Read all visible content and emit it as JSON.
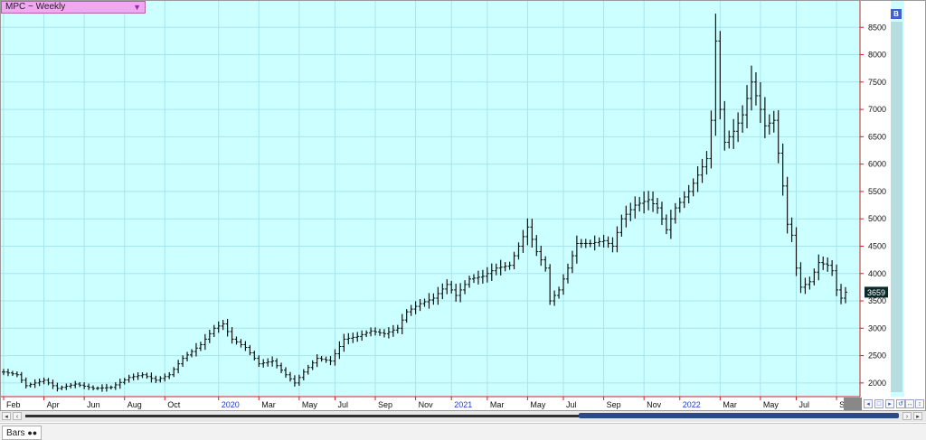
{
  "window": {
    "symbol_label": "MPC ~ Weekly",
    "badge": "B"
  },
  "status": {
    "view_tab": "Bars"
  },
  "colors": {
    "plot_bg": "#ccffff",
    "grid": "#a8e4ee",
    "axis": "#d02020",
    "bar": "#111111",
    "last_price_bg": "#0a2a2a"
  },
  "chart_data": {
    "type": "ohlc",
    "title": "",
    "xlabel": "",
    "ylabel": "",
    "ylim": [
      1750,
      8950
    ],
    "yticks": [
      2000,
      2500,
      3000,
      3500,
      4000,
      4500,
      5000,
      5500,
      6000,
      6500,
      7000,
      7500,
      8000,
      8500
    ],
    "last_price": 3659,
    "last_price_label": "3659",
    "xticks": [
      {
        "label": "Feb",
        "week": 0,
        "year": false
      },
      {
        "label": "Apr",
        "week": 9,
        "year": false
      },
      {
        "label": "Jun",
        "week": 18,
        "year": false
      },
      {
        "label": "Aug",
        "week": 27,
        "year": false
      },
      {
        "label": "Oct",
        "week": 36,
        "year": false
      },
      {
        "label": "2020",
        "week": 48,
        "year": true
      },
      {
        "label": "Mar",
        "week": 57,
        "year": false
      },
      {
        "label": "May",
        "week": 66,
        "year": false
      },
      {
        "label": "Jul",
        "week": 74,
        "year": false
      },
      {
        "label": "Sep",
        "week": 83,
        "year": false
      },
      {
        "label": "Nov",
        "week": 92,
        "year": false
      },
      {
        "label": "2021",
        "week": 100,
        "year": true
      },
      {
        "label": "Mar",
        "week": 108,
        "year": false
      },
      {
        "label": "May",
        "week": 117,
        "year": false
      },
      {
        "label": "Jul",
        "week": 125,
        "year": false
      },
      {
        "label": "Sep",
        "week": 134,
        "year": false
      },
      {
        "label": "Nov",
        "week": 143,
        "year": false
      },
      {
        "label": "2022",
        "week": 151,
        "year": true
      },
      {
        "label": "Mar",
        "week": 160,
        "year": false
      },
      {
        "label": "May",
        "week": 169,
        "year": false
      },
      {
        "label": "Jul",
        "week": 177,
        "year": false
      },
      {
        "label": "Sep",
        "week": 186,
        "year": false
      }
    ],
    "weeks": 189,
    "close_anchors": [
      [
        0,
        2200
      ],
      [
        3,
        2150
      ],
      [
        5,
        1950
      ],
      [
        9,
        2050
      ],
      [
        12,
        1900
      ],
      [
        16,
        1980
      ],
      [
        20,
        1900
      ],
      [
        24,
        1920
      ],
      [
        28,
        2100
      ],
      [
        31,
        2150
      ],
      [
        34,
        2050
      ],
      [
        37,
        2150
      ],
      [
        40,
        2450
      ],
      [
        44,
        2700
      ],
      [
        47,
        3000
      ],
      [
        49,
        3080
      ],
      [
        51,
        2800
      ],
      [
        54,
        2650
      ],
      [
        57,
        2350
      ],
      [
        60,
        2400
      ],
      [
        63,
        2150
      ],
      [
        65,
        2000
      ],
      [
        67,
        2200
      ],
      [
        70,
        2450
      ],
      [
        73,
        2400
      ],
      [
        76,
        2800
      ],
      [
        79,
        2850
      ],
      [
        82,
        2950
      ],
      [
        85,
        2900
      ],
      [
        88,
        3000
      ],
      [
        90,
        3300
      ],
      [
        93,
        3450
      ],
      [
        96,
        3550
      ],
      [
        99,
        3800
      ],
      [
        101,
        3600
      ],
      [
        104,
        3900
      ],
      [
        107,
        3950
      ],
      [
        110,
        4100
      ],
      [
        113,
        4150
      ],
      [
        115,
        4500
      ],
      [
        117,
        4850
      ],
      [
        119,
        4400
      ],
      [
        121,
        4100
      ],
      [
        122,
        3500
      ],
      [
        124,
        3700
      ],
      [
        126,
        4100
      ],
      [
        128,
        4550
      ],
      [
        131,
        4550
      ],
      [
        134,
        4600
      ],
      [
        136,
        4500
      ],
      [
        138,
        5000
      ],
      [
        141,
        5250
      ],
      [
        144,
        5350
      ],
      [
        146,
        5200
      ],
      [
        148,
        4800
      ],
      [
        150,
        5200
      ],
      [
        153,
        5500
      ],
      [
        155,
        5800
      ],
      [
        157,
        6100
      ],
      [
        158,
        6800
      ],
      [
        159,
        8250
      ],
      [
        160,
        7000
      ],
      [
        161,
        6400
      ],
      [
        163,
        6600
      ],
      [
        165,
        6900
      ],
      [
        167,
        7500
      ],
      [
        169,
        7000
      ],
      [
        170,
        6700
      ],
      [
        172,
        6800
      ],
      [
        173,
        6200
      ],
      [
        174,
        5600
      ],
      [
        175,
        4900
      ],
      [
        176,
        4700
      ],
      [
        177,
        4100
      ],
      [
        178,
        3750
      ],
      [
        180,
        3850
      ],
      [
        182,
        4200
      ],
      [
        184,
        4150
      ],
      [
        185,
        4050
      ],
      [
        186,
        3700
      ],
      [
        187,
        3550
      ],
      [
        188,
        3659
      ]
    ],
    "spikes": [
      [
        159,
        8750
      ],
      [
        167,
        7800
      ]
    ]
  }
}
